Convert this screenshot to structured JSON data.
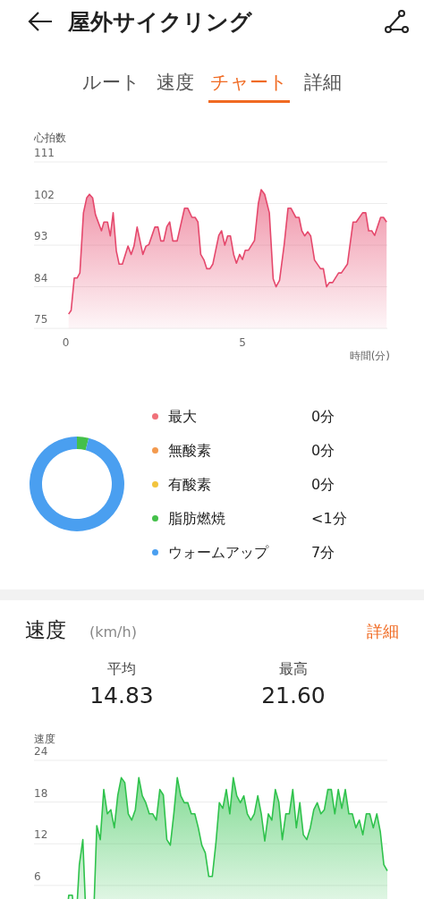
{
  "header": {
    "title": "屋外サイクリング"
  },
  "tabs": [
    {
      "label": "ルート",
      "selected": false
    },
    {
      "label": "速度",
      "selected": false
    },
    {
      "label": "チャート",
      "selected": true
    },
    {
      "label": "詳細",
      "selected": false
    }
  ],
  "heart_rate": {
    "chart_data": {
      "type": "area",
      "ylabel": "心拍数",
      "xlabel": "時間(分)",
      "grid": true,
      "ylim": [
        75,
        111
      ],
      "yticks": [
        111,
        102,
        93,
        84,
        75
      ],
      "xlim": [
        -0.9,
        9.1
      ],
      "xticks": [
        0,
        5
      ],
      "x": [
        0.08,
        0.15,
        0.24,
        0.32,
        0.4,
        0.5,
        0.59,
        0.67,
        0.76,
        0.84,
        1.01,
        1.08,
        1.18,
        1.26,
        1.34,
        1.43,
        1.51,
        1.6,
        1.76,
        1.85,
        1.93,
        2.02,
        2.18,
        2.27,
        2.35,
        2.52,
        2.61,
        2.69,
        2.77,
        2.86,
        2.94,
        3.03,
        3.15,
        3.36,
        3.45,
        3.57,
        3.66,
        3.74,
        3.82,
        3.91,
        3.99,
        4.08,
        4.16,
        4.33,
        4.41,
        4.5,
        4.58,
        4.66,
        4.75,
        4.83,
        4.92,
        5.0,
        5.08,
        5.17,
        5.34,
        5.45,
        5.53,
        5.63,
        5.76,
        5.87,
        5.95,
        6.05,
        6.18,
        6.29,
        6.37,
        6.51,
        6.6,
        6.68,
        6.76,
        6.85,
        6.93,
        7.04,
        7.21,
        7.29,
        7.38,
        7.46,
        7.55,
        7.72,
        7.8,
        7.97,
        8.13,
        8.22,
        8.4,
        8.49,
        8.57,
        8.66,
        8.74,
        8.91,
        8.99,
        9.08
      ],
      "series": [
        {
          "color": "#e5486c",
          "values": [
            78.1,
            78.9,
            85.9,
            85.9,
            87,
            100,
            103.2,
            104,
            103.2,
            99.6,
            96.1,
            98,
            98,
            95,
            100,
            91.8,
            88.9,
            88.9,
            92.8,
            91,
            92.8,
            96.9,
            91,
            92.8,
            93.1,
            96.9,
            96.9,
            93.9,
            93.9,
            97,
            98,
            93.9,
            93.9,
            101,
            101,
            99,
            99,
            98,
            91,
            89.8,
            87.9,
            87.9,
            88.9,
            95.1,
            96.1,
            93,
            95,
            95,
            91,
            89.1,
            91,
            89.9,
            91.9,
            91.9,
            94,
            102,
            105,
            104,
            100,
            85.7,
            84,
            85.4,
            93.1,
            101,
            101,
            99,
            99,
            96.1,
            95,
            95.9,
            95,
            89.8,
            87.9,
            87.9,
            84,
            84.9,
            84.9,
            87,
            87,
            88.9,
            98,
            98,
            100,
            100,
            96.1,
            96.1,
            95.1,
            99,
            99,
            98
          ]
        }
      ]
    }
  },
  "zones": {
    "chart_data": {
      "type": "donut",
      "categories": [
        "最大",
        "無酸素",
        "有酸素",
        "脂肪燃焼",
        "ウォームアップ"
      ],
      "series": [
        {
          "values": [
            0,
            0,
            0,
            4,
            96
          ]
        }
      ]
    },
    "items": [
      {
        "value": "0分",
        "color": "#f0717a"
      },
      {
        "value": "0分",
        "color": "#f39a4e"
      },
      {
        "value": "0分",
        "color": "#f2c43d"
      },
      {
        "value": "<1分",
        "color": "#44c04a"
      },
      {
        "value": "7分",
        "color": "#4a9ff0"
      }
    ]
  },
  "speed": {
    "title": "速度",
    "unit": "(km/h)",
    "link": "詳細",
    "stats": [
      {
        "label": "平均",
        "value": "14.83"
      },
      {
        "label": "最高",
        "value": "21.60"
      }
    ],
    "chart_data": {
      "type": "area",
      "ylabel": "速度",
      "grid": true,
      "ylim": [
        0,
        24
      ],
      "yticks": [
        24,
        18,
        12,
        6
      ],
      "series": [
        {
          "color": "#2fc24c",
          "values": [
            0,
            4.6,
            4.6,
            0,
            9,
            12.6,
            0,
            0,
            0,
            14.6,
            12.6,
            19.8,
            16.3,
            16.9,
            14.3,
            19,
            21.5,
            20.8,
            16.3,
            15.4,
            16.9,
            21.5,
            18.9,
            17.9,
            16.3,
            16.3,
            15.4,
            19.8,
            19,
            12.6,
            11.8,
            16.3,
            21.5,
            18.9,
            17.9,
            17.9,
            16.3,
            16.3,
            14.3,
            11.8,
            10.7,
            7.3,
            7.3,
            12,
            17.9,
            17.1,
            19.8,
            16.3,
            21.5,
            18.9,
            17.9,
            18.9,
            16.3,
            15.4,
            16.3,
            18.9,
            16.3,
            12.4,
            16.3,
            15.4,
            19.8,
            18,
            12.6,
            16.3,
            16.3,
            19.8,
            14.3,
            17.9,
            13.3,
            12.6,
            14.3,
            16.9,
            17.9,
            16.3,
            16.9,
            19.8,
            19.8,
            16.3,
            19.8,
            17.1,
            19.8,
            16.3,
            16.3,
            14.3,
            15.4,
            13.3,
            16.3,
            16.3,
            14.3,
            16.3,
            13.7,
            9,
            8.1
          ]
        }
      ]
    }
  }
}
